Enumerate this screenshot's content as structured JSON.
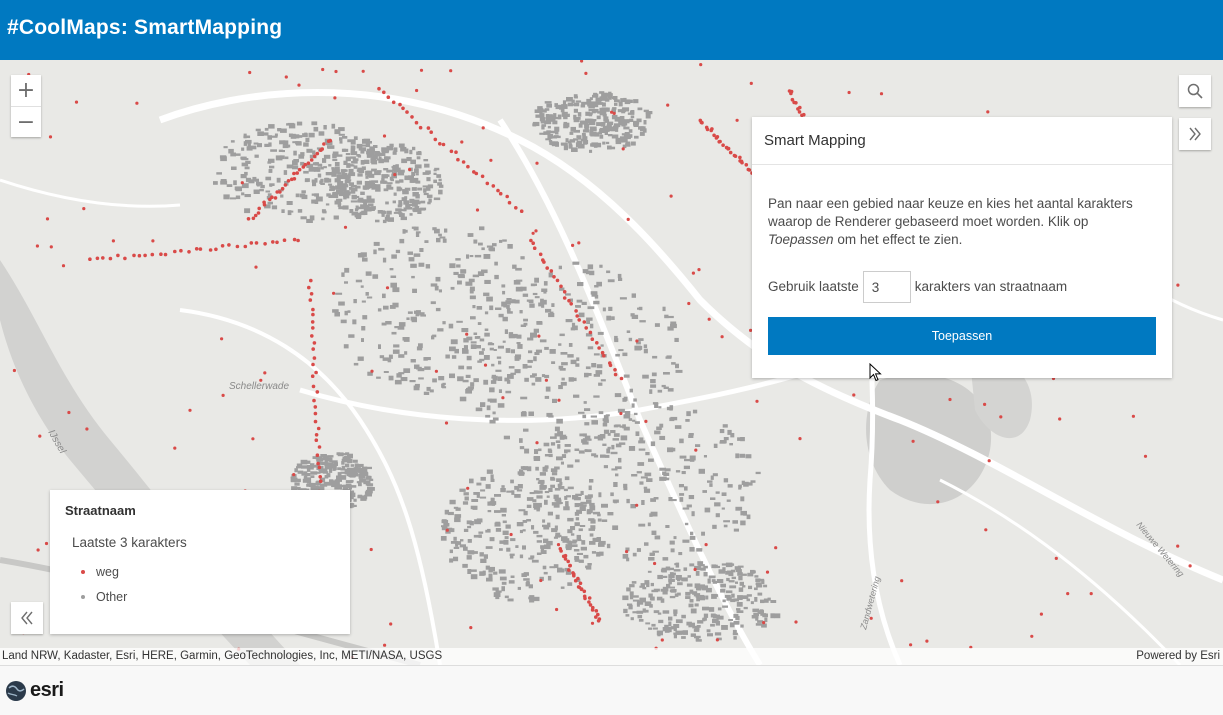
{
  "app": {
    "title": "#CoolMaps: SmartMapping"
  },
  "map": {
    "labels": {
      "river": "IJssel",
      "area": "Schellerwade",
      "canal": "Zandwetering",
      "road": "Nieuwe Wetering"
    },
    "colors": {
      "background": "#e9e9e6",
      "roads": "#ffffff",
      "buildings": "#9e9e9e",
      "water": "#cdcdcd",
      "points": "#d94a48"
    }
  },
  "zoom": {
    "in_label": "+",
    "out_label": "−"
  },
  "tools": {
    "search_icon": "search-icon",
    "expand_icon": "double-chevron-right-icon"
  },
  "panel": {
    "title": "Smart Mapping",
    "description_part1": "Pan naar een gebied naar keuze en kies het aantal karakters waarop de Renderer gebaseerd moet worden. Klik op ",
    "description_em": "Toepassen",
    "description_part2": " om het effect te zien.",
    "prefix_label": "Gebruik laatste",
    "input_value": "3",
    "suffix_label": "karakters van straatnaam",
    "apply_label": "Toepassen"
  },
  "legend": {
    "title": "Straatnaam",
    "subtitle": "Laatste 3 karakters",
    "items": [
      {
        "label": "weg",
        "color": "#d94a48"
      },
      {
        "label": "Other",
        "color": "#9e9e9e"
      }
    ]
  },
  "attribution": {
    "left": "Land NRW, Kadaster, Esri, HERE, Garmin, GeoTechnologies, Inc, METI/NASA, USGS",
    "right": "Powered by Esri"
  },
  "footer": {
    "logo_text": "esri"
  },
  "colors": {
    "accent": "#0079c1",
    "header_text": "#ffffff"
  }
}
